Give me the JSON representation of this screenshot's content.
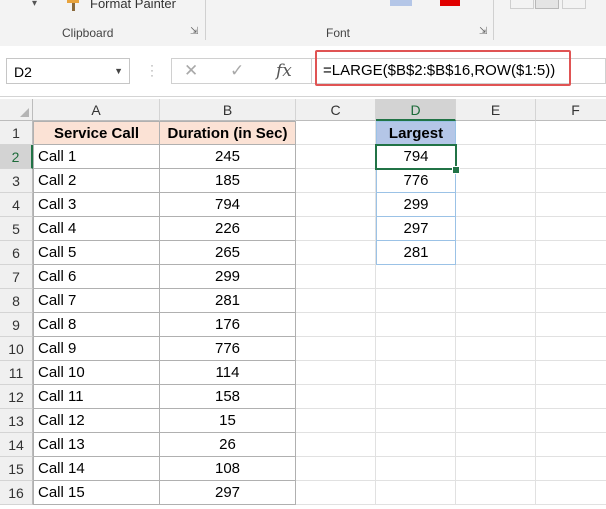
{
  "ribbon": {
    "format_painter_label": "Format Painter",
    "groups": [
      {
        "label": "Clipboard"
      },
      {
        "label": "Font"
      }
    ]
  },
  "formula_bar": {
    "name_box": "D2",
    "formula": "=LARGE($B$2:$B$16,ROW($1:5))"
  },
  "columns": [
    "A",
    "B",
    "C",
    "D",
    "E",
    "F"
  ],
  "rows": [
    "1",
    "2",
    "3",
    "4",
    "5",
    "6",
    "7",
    "8",
    "9",
    "10",
    "11",
    "12",
    "13",
    "14",
    "15",
    "16"
  ],
  "table": {
    "headers": [
      "Service Call",
      "Duration (in Sec)"
    ],
    "rows": [
      {
        "call": "Call 1",
        "duration": "245"
      },
      {
        "call": "Call 2",
        "duration": "185"
      },
      {
        "call": "Call 3",
        "duration": "794"
      },
      {
        "call": "Call 4",
        "duration": "226"
      },
      {
        "call": "Call 5",
        "duration": "265"
      },
      {
        "call": "Call 6",
        "duration": "299"
      },
      {
        "call": "Call 7",
        "duration": "281"
      },
      {
        "call": "Call 8",
        "duration": "176"
      },
      {
        "call": "Call 9",
        "duration": "776"
      },
      {
        "call": "Call 10",
        "duration": "114"
      },
      {
        "call": "Call 11",
        "duration": "158"
      },
      {
        "call": "Call 12",
        "duration": "15"
      },
      {
        "call": "Call 13",
        "duration": "26"
      },
      {
        "call": "Call 14",
        "duration": "108"
      },
      {
        "call": "Call 15",
        "duration": "297"
      }
    ]
  },
  "largest": {
    "header": "Largest",
    "values": [
      "794",
      "776",
      "299",
      "297",
      "281"
    ]
  },
  "colors": {
    "accent_green": "#217346",
    "highlight_red": "#e05454",
    "header_peach": "#fbe2d5",
    "header_blue": "#b4c6e7"
  }
}
